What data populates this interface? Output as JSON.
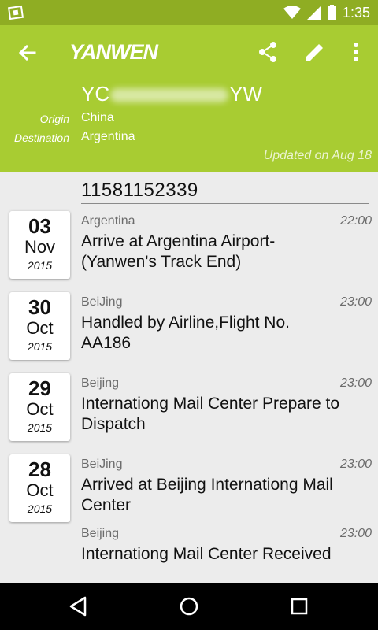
{
  "status_bar": {
    "time": "1:35",
    "icons": [
      "app-icon",
      "wifi-icon",
      "signal-icon",
      "battery-icon"
    ]
  },
  "app_bar": {
    "logo": "YANWEN",
    "actions": [
      "share-icon",
      "edit-icon",
      "more-vert-icon"
    ],
    "tracking_code_prefix": "YC",
    "tracking_code_suffix": "YW",
    "origin_label": "Origin",
    "origin_value": "China",
    "destination_label": "Destination",
    "destination_value": "Argentina",
    "updated": "Updated on Aug 18"
  },
  "tracking_number": "11581152339",
  "events": [
    {
      "day": "03",
      "month": "Nov",
      "year": "2015",
      "location": "Argentina",
      "time": "22:00",
      "description": "Arrive at Argentina Airport-(Yanwen's Track End)"
    },
    {
      "day": "30",
      "month": "Oct",
      "year": "2015",
      "location": "BeiJing",
      "time": "23:00",
      "description": "Handled by Airline,Flight No. AA186"
    },
    {
      "day": "29",
      "month": "Oct",
      "year": "2015",
      "location": "Beijing",
      "time": "23:00",
      "description": "Internationg Mail Center Prepare to Dispatch"
    },
    {
      "day": "28",
      "month": "Oct",
      "year": "2015",
      "location": "BeiJing",
      "time": "23:00",
      "description": "Arrived at Beijing Internationg Mail Center"
    },
    {
      "day": "",
      "month": "",
      "year": "",
      "location": "Beijing",
      "time": "23:00",
      "description": "Internationg Mail Center Received"
    }
  ],
  "colors": {
    "status_bar": "#8fad23",
    "app_bar": "#a8cc32",
    "background": "#ececec"
  }
}
